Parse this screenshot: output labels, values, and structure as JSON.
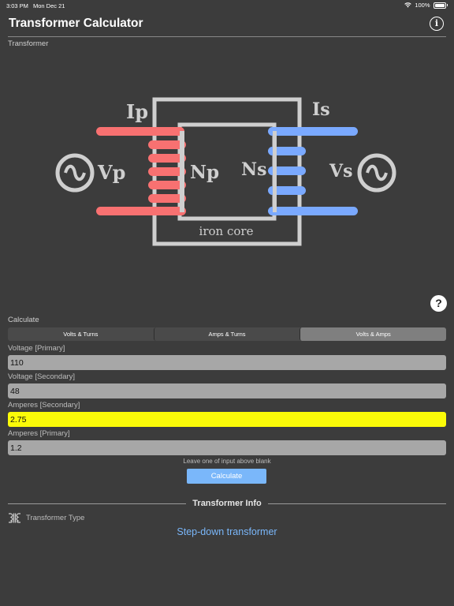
{
  "status": {
    "time": "3:03 PM",
    "date": "Mon Dec 21",
    "battery": "100%"
  },
  "nav": {
    "title": "Transformer Calculator",
    "info_icon": "info-icon"
  },
  "diagram_section": {
    "label": "Transformer"
  },
  "diagram": {
    "ip": "Ip",
    "is": "Is",
    "vp": "Vp",
    "vs": "Vs",
    "np": "Np",
    "ns": "Ns",
    "core": "iron core",
    "primary_color": "#f87171",
    "secondary_color": "#7aa9ff"
  },
  "calc": {
    "label": "Calculate",
    "tabs": [
      "Volts & Turns",
      "Amps & Turns",
      "Volts & Amps"
    ],
    "active_tab": 2,
    "fields": [
      {
        "label": "Voltage [Primary]",
        "value": "110"
      },
      {
        "label": "Voltage [Secondary]",
        "value": "48"
      },
      {
        "label": "Amperes [Secondary]",
        "value": "2.75"
      },
      {
        "label": "Amperes [Primary]",
        "value": "1.2"
      }
    ],
    "highlight_color": "#fbfb08",
    "hint": "Leave one of input above blank",
    "button": "Calculate"
  },
  "info": {
    "title": "Transformer Info",
    "type_label": "Transformer Type",
    "result": "Step-down transformer",
    "link_color": "#7ab7fa"
  }
}
